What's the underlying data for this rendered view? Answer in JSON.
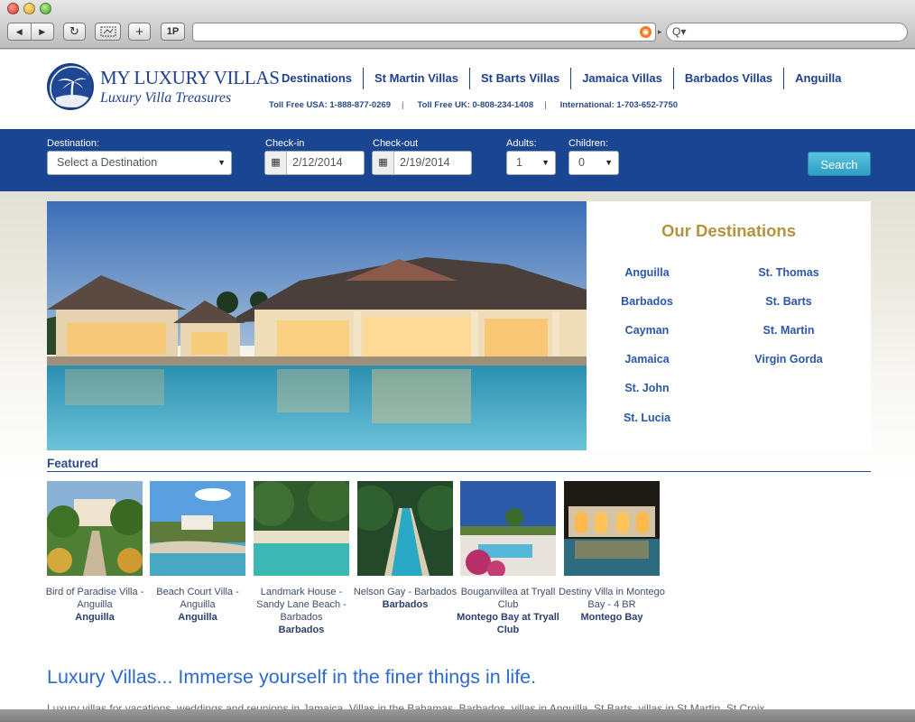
{
  "browser": {
    "reload_icon": "reload-icon",
    "add_label": "+",
    "onepass_label": "1P",
    "search_label": "Q▾",
    "url_value": "",
    "url_separator": "▸"
  },
  "header": {
    "logo_title": "MY LUXURY VILLAS",
    "logo_subtitle": "Luxury Villa Treasures",
    "nav": [
      "Destinations",
      "St Martin Villas",
      "St Barts Villas",
      "Jamaica Villas",
      "Barbados Villas",
      "Anguilla"
    ],
    "phones": [
      "Toll Free USA: 1-888-877-0269",
      "Toll Free UK: 0-808-234-1408",
      "International: 1-703-652-7750"
    ],
    "phone_separator": "|"
  },
  "search": {
    "destination_label": "Destination:",
    "destination_value": "Select a Destination",
    "checkin_label": "Check-in",
    "checkin_value": "2/12/2014",
    "checkout_label": "Check-out",
    "checkout_value": "2/19/2014",
    "adults_label": "Adults:",
    "adults_value": "1",
    "children_label": "Children:",
    "children_value": "0",
    "button_label": "Search",
    "calendar_glyph": "▦",
    "arrow_glyph": "▼"
  },
  "destinations": {
    "title": "Our Destinations",
    "left": [
      "Anguilla",
      "Barbados",
      "Cayman",
      "Jamaica",
      "St. John",
      "St. Lucia"
    ],
    "right": [
      "St. Thomas",
      "St. Barts",
      "St. Martin",
      "Virgin Gorda"
    ]
  },
  "featured": {
    "heading": "Featured",
    "items": [
      {
        "name": "Bird of Paradise Villa - Anguilla",
        "location": "Anguilla"
      },
      {
        "name": "Beach Court Villa - Anguilla",
        "location": "Anguilla"
      },
      {
        "name": "Landmark House - Sandy Lane Beach - Barbados",
        "location": "Barbados"
      },
      {
        "name": "Nelson Gay - Barbados",
        "location": "Barbados"
      },
      {
        "name": "Bouganvillea at Tryall Club",
        "location": "Montego Bay at Tryall Club"
      },
      {
        "name": "Destiny Villa in Montego Bay - 4 BR",
        "location": "Montego Bay"
      }
    ]
  },
  "content": {
    "tagline": "Luxury Villas... Immerse yourself in the finer things in life.",
    "intro": "Luxury villas for vacations, weddings and reunions in Jamaica. Villas in the Bahamas, Barbados, villas in Anguilla, St Barts, villas in St Martin, St Croix"
  },
  "colors": {
    "brand_blue": "#1a4593",
    "accent_gold": "#b39340",
    "link_blue": "#2b57a8",
    "button_teal": "#2d9ec4"
  }
}
